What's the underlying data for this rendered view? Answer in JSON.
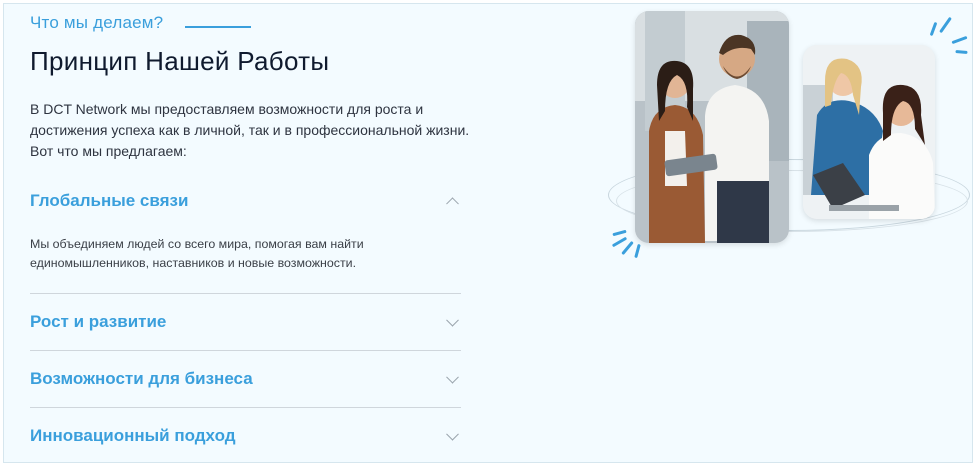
{
  "section": {
    "eyebrow": "Что мы делаем?",
    "title": "Принцип Нашей Работы",
    "intro": "В DCT Network мы предоставляем возможности для роста и достижения успеха как в личной, так и в профессиональной жизни. Вот что мы предлагаем:"
  },
  "accordion": [
    {
      "title": "Глобальные связи",
      "expanded": true,
      "body": "Мы объединяем людей со всего мира, помогая вам найти единомышленников, наставников и новые возможности."
    },
    {
      "title": "Рост и развитие",
      "expanded": false
    },
    {
      "title": "Возможности для бизнеса",
      "expanded": false
    },
    {
      "title": "Инновационный подход",
      "expanded": false
    }
  ],
  "colors": {
    "accent": "#3a9fdc",
    "background": "#f3fbff",
    "heading": "#0f1a2e"
  },
  "icons": {
    "expanded": "chevron-up-icon",
    "collapsed": "chevron-down-icon"
  }
}
